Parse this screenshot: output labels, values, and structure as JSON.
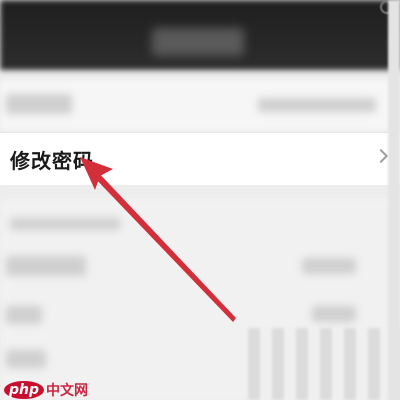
{
  "settings_list": {
    "change_password_label": "修改密码"
  },
  "watermark": {
    "logo_text": "php",
    "site_text": "中文网"
  },
  "colors": {
    "arrow": "#d32f3a",
    "header_background": "#242424",
    "page_background": "#ededed",
    "watermark_red": "#c8102e"
  },
  "icons": {
    "row_chevron": "chevron-right-icon",
    "status_bar": "status-icon"
  }
}
